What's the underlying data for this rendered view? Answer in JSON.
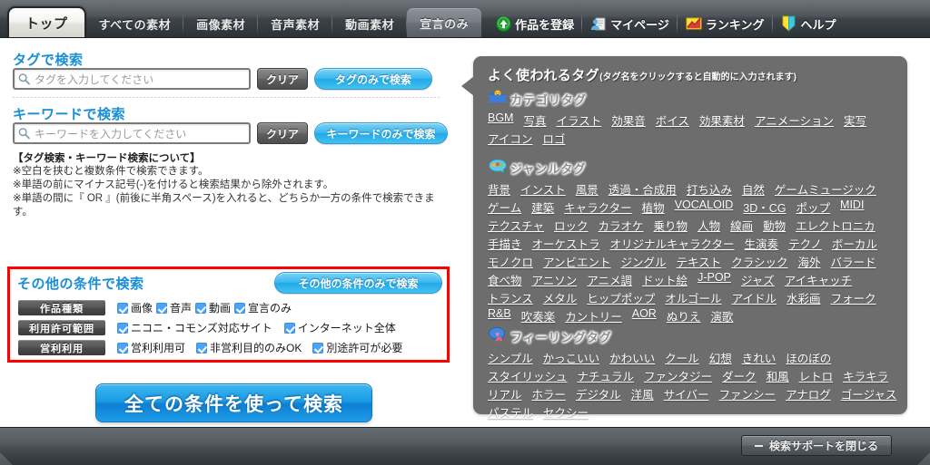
{
  "nav": {
    "tabs": [
      {
        "label": "トップ",
        "active": true
      },
      {
        "label": "すべての素材",
        "active": false
      },
      {
        "label": "画像素材",
        "active": false
      },
      {
        "label": "音声素材",
        "active": false
      },
      {
        "label": "動画素材",
        "active": false
      },
      {
        "label": "宣言のみ",
        "active": false
      }
    ],
    "links": [
      {
        "label": "作品を登録",
        "icon": "upload-arrow-icon"
      },
      {
        "label": "マイページ",
        "icon": "user-page-icon"
      },
      {
        "label": "ランキング",
        "icon": "ranking-chart-icon"
      },
      {
        "label": "ヘルプ",
        "icon": "help-badge-icon"
      }
    ]
  },
  "search": {
    "tag": {
      "title": "タグで検索",
      "placeholder": "タグを入力してください",
      "value": "",
      "clear_label": "クリア",
      "submit_label": "タグのみで検索"
    },
    "keyword": {
      "title": "キーワードで検索",
      "placeholder": "キーワードを入力してください",
      "value": "",
      "clear_label": "クリア",
      "submit_label": "キーワードのみで検索"
    },
    "notes": {
      "heading": "【タグ検索・キーワード検索について】",
      "lines": [
        "※空白を挟むと複数条件で検索できます。",
        "※単語の前にマイナス記号(-)を付けると検索結果から除外されます。",
        "※単語の間に『 OR 』(前後に半角スペース)を入れると、どちらか一方の条件で検索できます。"
      ]
    },
    "other": {
      "title": "その他の条件で検索",
      "submit_label": "その他の条件のみで検索",
      "groups": [
        {
          "label": "作品種類",
          "options": [
            {
              "label": "画像",
              "checked": true
            },
            {
              "label": "音声",
              "checked": true
            },
            {
              "label": "動画",
              "checked": true
            },
            {
              "label": "宣言のみ",
              "checked": true
            }
          ]
        },
        {
          "label": "利用許可範囲",
          "options": [
            {
              "label": "ニコニ・コモンズ対応サイト",
              "checked": true
            },
            {
              "label": "インターネット全体",
              "checked": true
            }
          ]
        },
        {
          "label": "営利利用",
          "options": [
            {
              "label": "営利利用可",
              "checked": true
            },
            {
              "label": "非営利目的のみOK",
              "checked": true
            },
            {
              "label": "別途許可が必要",
              "checked": true
            }
          ]
        }
      ]
    },
    "submit_all_label": "全ての条件を使って検索"
  },
  "tagpanel": {
    "title": "よく使われるタグ",
    "subtitle": "(タグ名をクリックすると自動的に入力されます)",
    "groups": [
      {
        "label": "カテゴリタグ",
        "icon": "category-folder-icon",
        "tags": [
          "BGM",
          "写真",
          "イラスト",
          "効果音",
          "ボイス",
          "効果素材",
          "アニメーション",
          "実写",
          "アイコン",
          "ロゴ"
        ]
      },
      {
        "label": "ジャンルタグ",
        "icon": "genre-palette-icon",
        "tags": [
          "背景",
          "インスト",
          "風景",
          "透過・合成用",
          "打ち込み",
          "自然",
          "ゲームミュージック",
          "ゲーム",
          "建築",
          "キャラクター",
          "植物",
          "VOCALOID",
          "3D・CG",
          "ポップ",
          "MIDI",
          "テクスチャ",
          "ロック",
          "カラオケ",
          "乗り物",
          "人物",
          "線画",
          "動物",
          "エレクトロニカ",
          "手描き",
          "オーケストラ",
          "オリジナルキャラクター",
          "生演奏",
          "テクノ",
          "ボーカル",
          "モノクロ",
          "アンビエント",
          "ジングル",
          "テキスト",
          "クラシック",
          "海外",
          "バラード",
          "食べ物",
          "アニソン",
          "アニメ調",
          "ドット絵",
          "J-POP",
          "ジャズ",
          "アイキャッチ",
          "トランス",
          "メタル",
          "ヒップポップ",
          "オルゴール",
          "アイドル",
          "水彩画",
          "フォーク",
          "R&B",
          "吹奏楽",
          "カントリー",
          "AOR",
          "ぬりえ",
          "演歌"
        ]
      },
      {
        "label": "フィーリングタグ",
        "icon": "feeling-heart-icon",
        "tags": [
          "シンプル",
          "かっこいい",
          "かわいい",
          "クール",
          "幻想",
          "きれい",
          "ほのぼの",
          "スタイリッシュ",
          "ナチュラル",
          "ファンタジー",
          "ダーク",
          "和風",
          "レトロ",
          "キラキラ",
          "リアル",
          "ホラー",
          "デジタル",
          "洋風",
          "サイバー",
          "ファンシー",
          "アナログ",
          "ゴージャス",
          "パステル",
          "セクシー"
        ]
      }
    ]
  },
  "footer": {
    "close_label": "検索サポートを閉じる"
  },
  "colors": {
    "accent_blue": "#1c8fd4",
    "button_blue": "#21a9e8",
    "highlight_red": "#ff0000",
    "panel_gray": "#6d6d6d",
    "nav_dark": "#3d4348"
  }
}
